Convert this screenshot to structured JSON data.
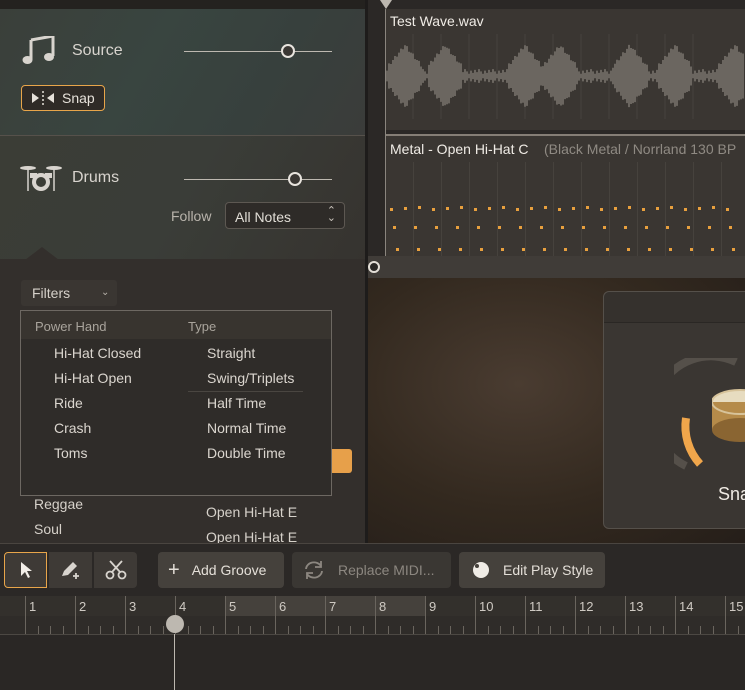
{
  "source": {
    "title": "Source",
    "slider_value_pct": 75,
    "snap_label": "Snap"
  },
  "drums": {
    "title": "Drums",
    "slider_value_pct": 78,
    "follow_label": "Follow",
    "follow_value": "All Notes"
  },
  "filters": {
    "label": "Filters",
    "col1_header": "Power Hand",
    "col2_header": "Type",
    "power_hand": [
      "Hi-Hat Closed",
      "Hi-Hat Open",
      "Ride",
      "Crash",
      "Toms"
    ],
    "type": [
      "Straight",
      "Swing/Triplets",
      "Half Time",
      "Normal Time",
      "Double Time"
    ]
  },
  "below_list": {
    "genres": [
      "Reggae",
      "Soul"
    ],
    "hits": [
      "Open Hi-Hat E",
      "Open Hi-Hat E"
    ]
  },
  "tracks": {
    "audio_title": "Test Wave.wav",
    "midi_title": "Metal - Open Hi-Hat C",
    "midi_subtitle": "(Black Metal / Norrland 130 BP"
  },
  "plugin": {
    "card_label": "Sna"
  },
  "toolbar": {
    "add_groove": "Add Groove",
    "replace_midi": "Replace MIDI...",
    "edit_play_style": "Edit Play Style"
  },
  "timeline": {
    "bars": [
      "1",
      "2",
      "3",
      "4",
      "5",
      "6",
      "7",
      "8",
      "9",
      "10",
      "11",
      "12",
      "13",
      "14",
      "15"
    ]
  },
  "colors": {
    "accent": "#e8a54a",
    "background": "#2a2727",
    "panel": "#3a3632"
  }
}
